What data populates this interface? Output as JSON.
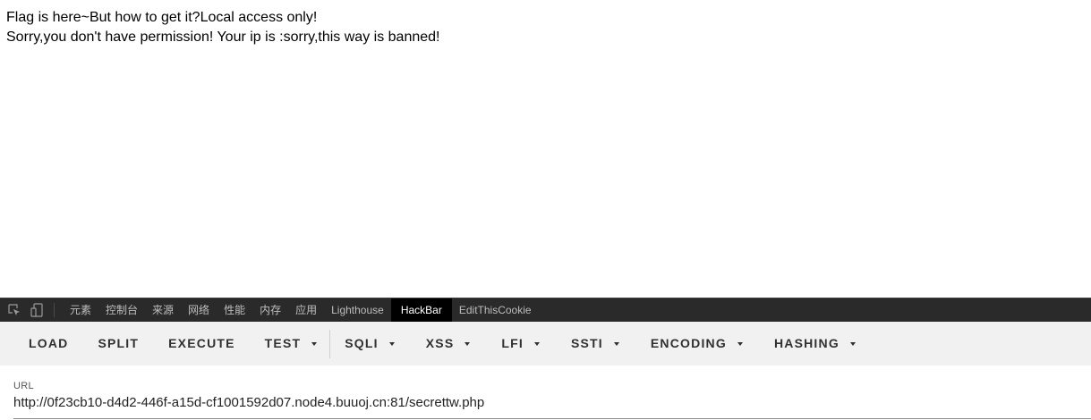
{
  "page": {
    "lines": [
      "Flag is here~But how to get it?Local access only!",
      "Sorry,you don't have permission!  Your ip is :sorry,this way is banned!"
    ]
  },
  "devtools": {
    "icons": [
      "inspect-element-icon",
      "device-toolbar-icon"
    ],
    "tabs": [
      {
        "label": "元素"
      },
      {
        "label": "控制台"
      },
      {
        "label": "来源"
      },
      {
        "label": "网络"
      },
      {
        "label": "性能"
      },
      {
        "label": "内存"
      },
      {
        "label": "应用"
      },
      {
        "label": "Lighthouse"
      },
      {
        "label": "HackBar",
        "active": true
      },
      {
        "label": "EditThisCookie"
      }
    ]
  },
  "hackbar": {
    "buttons": {
      "load": "LOAD",
      "split": "SPLIT",
      "execute": "EXECUTE",
      "test": "TEST",
      "sqli": "SQLI",
      "xss": "XSS",
      "lfi": "LFI",
      "ssti": "SSTI",
      "encoding": "ENCODING",
      "hashing": "HASHING"
    },
    "url_label": "URL",
    "url_value": "http://0f23cb10-d4d2-446f-a15d-cf1001592d07.node4.buuoj.cn:81/secrettw.php"
  },
  "colors": {
    "devtools_bg": "#2a2a2a",
    "active_tab_bg": "#000000",
    "toolbar_bg": "#f1f1f1"
  }
}
